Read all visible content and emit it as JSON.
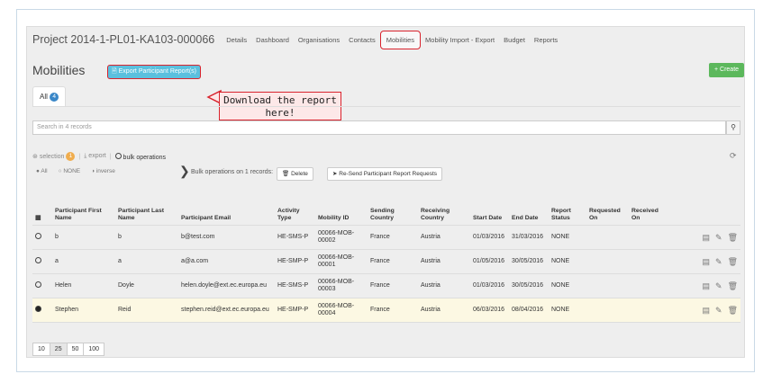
{
  "header": {
    "project_title": "Project 2014-1-PL01-KA103-000066",
    "tabs": [
      "Details",
      "Dashboard",
      "Organisations",
      "Contacts",
      "Mobilities",
      "Mobility Import - Export",
      "Budget",
      "Reports"
    ],
    "active_tab": "Mobilities"
  },
  "page": {
    "title": "Mobilities",
    "export_label": "Export Participant Report(s)",
    "create_label": "+ Create",
    "callout_line1": "Download the report",
    "callout_line2": "here!"
  },
  "filter_tabs": {
    "all_label": "All",
    "all_count": "4"
  },
  "search": {
    "placeholder": "Search in 4 records"
  },
  "selection": {
    "selection_label": "selection",
    "selection_count": "1",
    "export_label": "export",
    "bulk_label": "bulk operations",
    "opt_all": "All",
    "opt_none": "NONE",
    "opt_inverse": "inverse",
    "bulk_ops_text": "Bulk operations on 1 records:",
    "delete_label": "Delete",
    "resend_label": "Re-Send Participant Report Requests"
  },
  "table": {
    "columns": [
      "Participant First Name",
      "Participant Last Name",
      "Participant Email",
      "Activity Type",
      "Mobility ID",
      "Sending Country",
      "Receiving Country",
      "Start Date",
      "End Date",
      "Report Status",
      "Requested On",
      "Received On"
    ],
    "rows": [
      {
        "selected": false,
        "first": "b",
        "last": "b",
        "email": "b@test.com",
        "activity": "HE-SMS-P",
        "mobility_id": "00066-MOB-00002",
        "sending": "France",
        "receiving": "Austria",
        "start": "01/03/2016",
        "end": "31/03/2016",
        "status": "NONE",
        "requested": "",
        "received": ""
      },
      {
        "selected": false,
        "first": "a",
        "last": "a",
        "email": "a@a.com",
        "activity": "HE-SMP-P",
        "mobility_id": "00066-MOB-00001",
        "sending": "France",
        "receiving": "Austria",
        "start": "01/05/2016",
        "end": "30/05/2016",
        "status": "NONE",
        "requested": "",
        "received": ""
      },
      {
        "selected": false,
        "first": "Helen",
        "last": "Doyle",
        "email": "helen.doyle@ext.ec.europa.eu",
        "activity": "HE-SMS-P",
        "mobility_id": "00066-MOB-00003",
        "sending": "France",
        "receiving": "Austria",
        "start": "01/03/2016",
        "end": "30/05/2016",
        "status": "NONE",
        "requested": "",
        "received": ""
      },
      {
        "selected": true,
        "first": "Stephen",
        "last": "Reid",
        "email": "stephen.reid@ext.ec.europa.eu",
        "activity": "HE-SMP-P",
        "mobility_id": "00066-MOB-00004",
        "sending": "France",
        "receiving": "Austria",
        "start": "06/03/2016",
        "end": "08/04/2016",
        "status": "NONE",
        "requested": "",
        "received": ""
      }
    ]
  },
  "pagination": {
    "sizes": [
      "10",
      "25",
      "50",
      "100"
    ],
    "active": "25"
  },
  "colors": {
    "accent_red": "#d9232d",
    "info_blue": "#5bc0de",
    "success_green": "#5cb85c",
    "badge_blue": "#3a87c8",
    "highlight_row": "#fcf8e3"
  }
}
